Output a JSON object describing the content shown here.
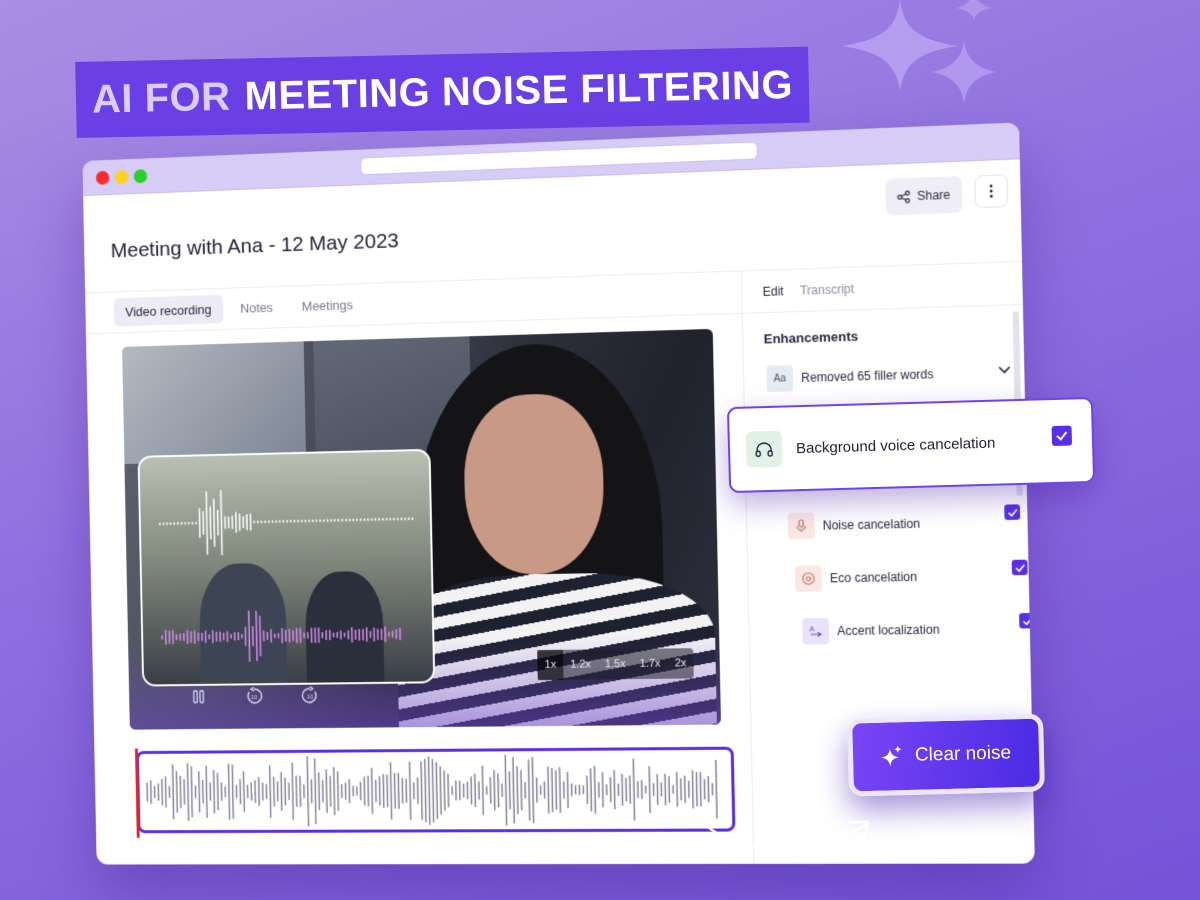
{
  "headline": {
    "part1": "AI FOR",
    "part2": "MEETING NOISE FILTERING"
  },
  "colors": {
    "accent": "#5a2de6",
    "background": "#8f6fe0",
    "playhead": "#e0242a"
  },
  "window": {
    "title": "Meeting with Ana - 12 May 2023",
    "share_label": "Share",
    "more_icon": "more-vertical-icon"
  },
  "left_tabs": [
    "Video recording",
    "Notes",
    "Meetings"
  ],
  "video": {
    "speeds": [
      "1x",
      "1.2x",
      "1.5x",
      "1.7x",
      "2x"
    ],
    "selected_speed": "1x",
    "controls": {
      "pause": "pause-icon",
      "rewind": "rewind-10-icon",
      "forward": "forward-10-icon"
    },
    "skip_seconds": "10"
  },
  "right_tabs": [
    "Edit",
    "Transcript"
  ],
  "enhancements": {
    "title": "Enhancements",
    "filler": {
      "icon_text": "Aa",
      "label": "Removed 65 filler words"
    },
    "floating": {
      "label": "Background voice cancelation",
      "checked": true
    },
    "items": [
      {
        "label": "Noise cancelation",
        "icon": "microphone-icon",
        "checked": true
      },
      {
        "label": "Eco cancelation",
        "icon": "target-icon",
        "checked": true
      },
      {
        "label": "Accent localization",
        "icon": "translate-icon",
        "checked": true
      }
    ]
  },
  "clear_button": {
    "label": "Clear noise",
    "icon": "sparkle-icon"
  }
}
